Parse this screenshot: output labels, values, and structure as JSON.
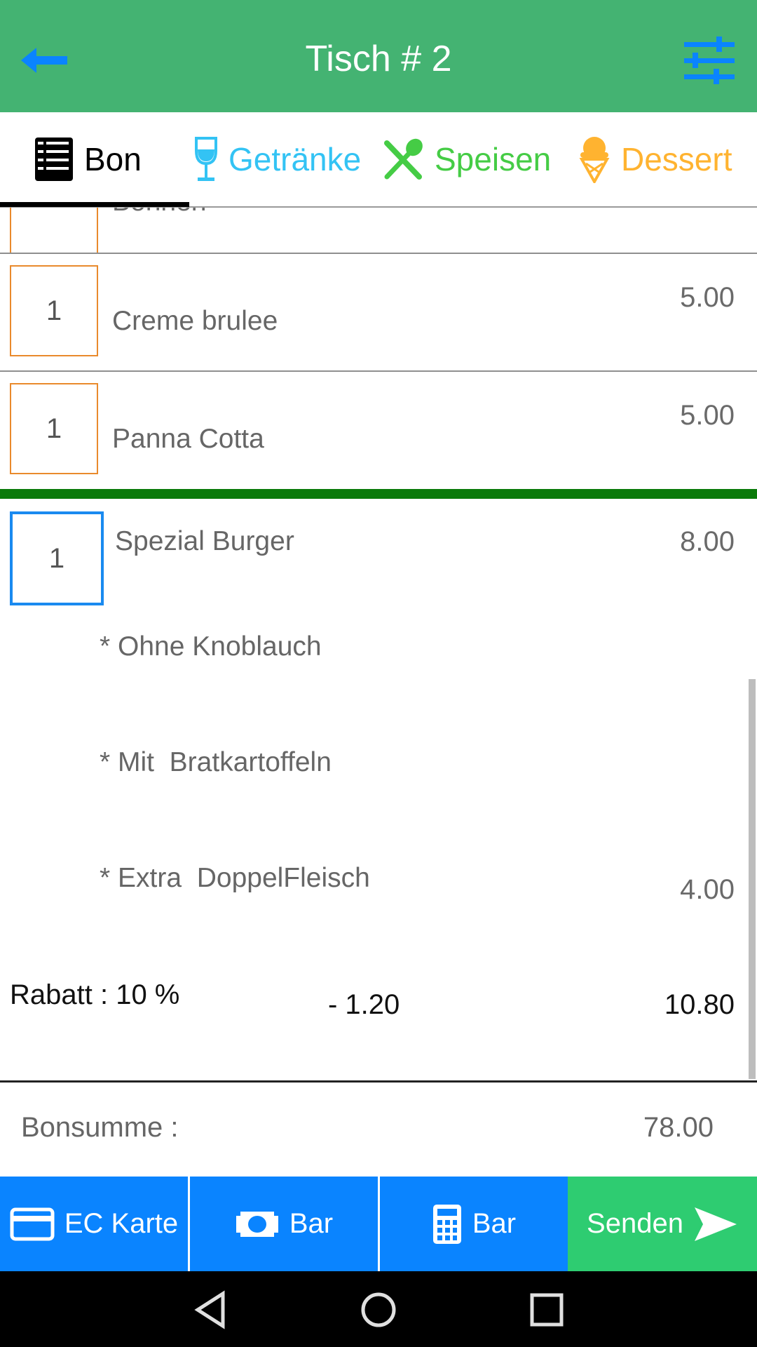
{
  "header": {
    "title": "Tisch # 2",
    "back_icon": "arrow-left-icon",
    "settings_icon": "sliders-icon",
    "bg_color": "#44b372"
  },
  "tabs": [
    {
      "label": "Bon",
      "icon": "receipt-icon",
      "color": "#000000",
      "active": true
    },
    {
      "label": "Getränke",
      "icon": "wine-glass-icon",
      "color": "#33c3f4"
    },
    {
      "label": "Speisen",
      "icon": "fork-spoon-icon",
      "color": "#45cc45"
    },
    {
      "label": "Dessert",
      "icon": "ice-cream-icon",
      "color": "#ffb330"
    }
  ],
  "items": [
    {
      "qty": "",
      "name": "Bohnen",
      "price": ""
    },
    {
      "qty": "1",
      "name": "Creme brulee",
      "price": "5.00"
    },
    {
      "qty": "1",
      "name": "Panna Cotta",
      "price": "5.00"
    }
  ],
  "selected_item": {
    "qty": "1",
    "name": "Spezial Burger",
    "price": "8.00",
    "modifiers": [
      {
        "text": "* Ohne Knoblauch",
        "price": ""
      },
      {
        "text": "* Mit  Bratkartoffeln",
        "price": ""
      },
      {
        "text": "* Extra  DoppelFleisch",
        "price": "4.00"
      }
    ],
    "discount_label": "Rabatt : 10 %",
    "discount_amount": "- 1.20",
    "line_total": "10.80"
  },
  "total": {
    "label": "Bonsumme  :",
    "value": "78.00"
  },
  "actions": [
    {
      "label": "EC Karte",
      "icon": "credit-card-icon",
      "color": "#0a84ff"
    },
    {
      "label": "Bar",
      "icon": "banknote-icon",
      "color": "#0a84ff"
    },
    {
      "label": "Bar",
      "icon": "calculator-icon",
      "color": "#0a84ff"
    },
    {
      "label": "Senden",
      "icon": "send-icon",
      "color": "#2ecc71"
    }
  ],
  "nav": [
    "back-icon",
    "home-icon",
    "recents-icon"
  ]
}
